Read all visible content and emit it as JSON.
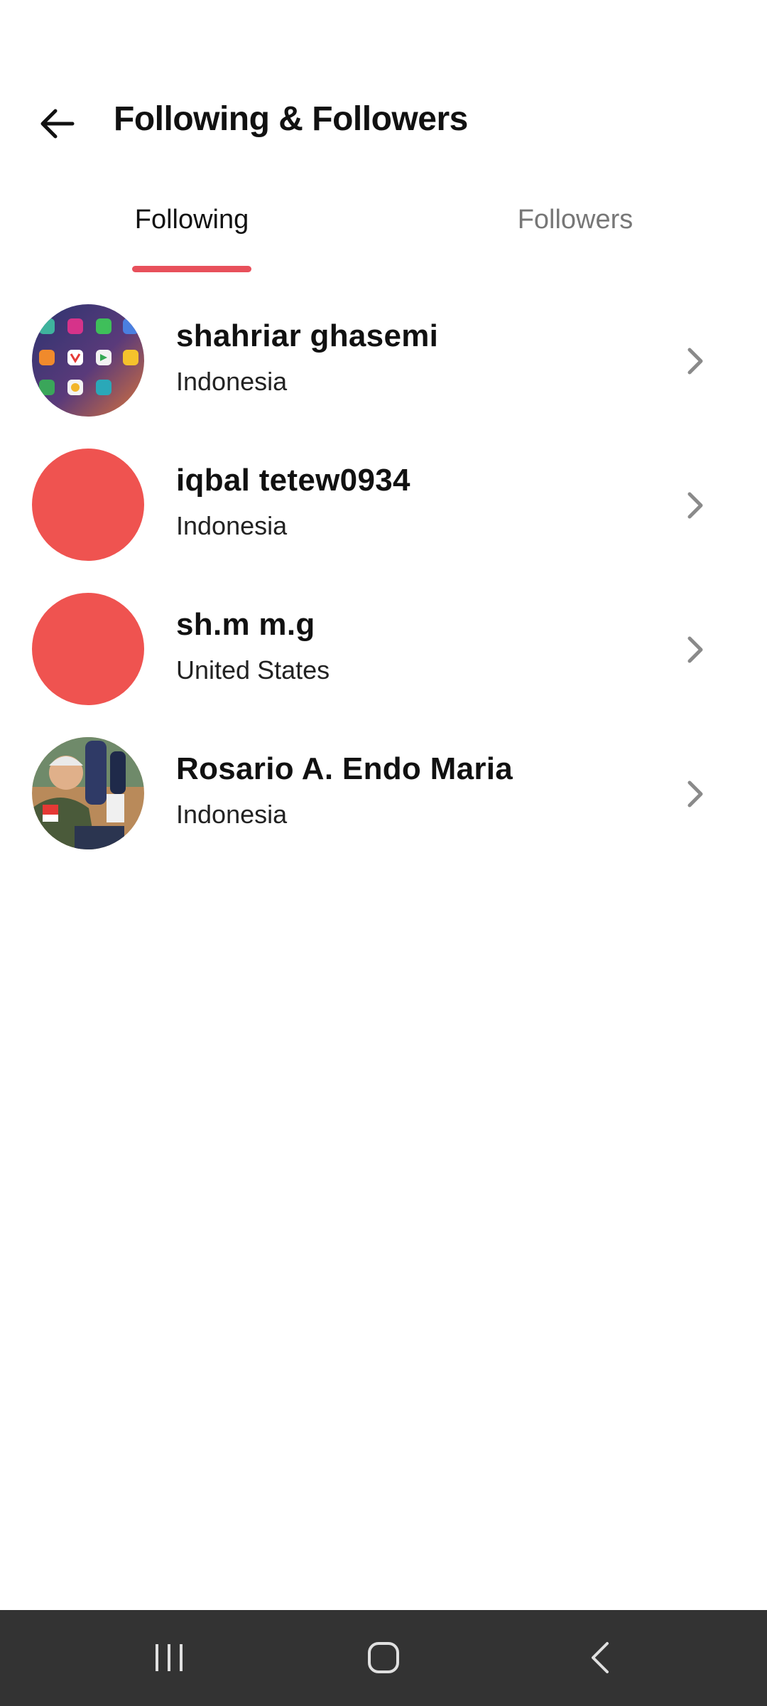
{
  "header": {
    "title": "Following & Followers",
    "back_icon": "arrow-left-icon"
  },
  "tabs": [
    {
      "label": "Following",
      "active": true
    },
    {
      "label": "Followers",
      "active": false
    }
  ],
  "colors": {
    "accent": "#e8505b",
    "avatar_placeholder": "#ef5350",
    "navbar": "#333333"
  },
  "following": [
    {
      "name": "shahriar ghasemi",
      "country": "Indonesia",
      "avatar": "app-grid-photo"
    },
    {
      "name": "iqbal tetew0934",
      "country": "Indonesia",
      "avatar": "red-placeholder"
    },
    {
      "name": "sh.m m.g",
      "country": "United States",
      "avatar": "red-placeholder"
    },
    {
      "name": "Rosario A. Endo Maria",
      "country": "Indonesia",
      "avatar": "person-photo"
    }
  ],
  "system_nav": {
    "recents_icon": "recents-icon",
    "home_icon": "home-icon",
    "back_icon": "back-icon"
  }
}
